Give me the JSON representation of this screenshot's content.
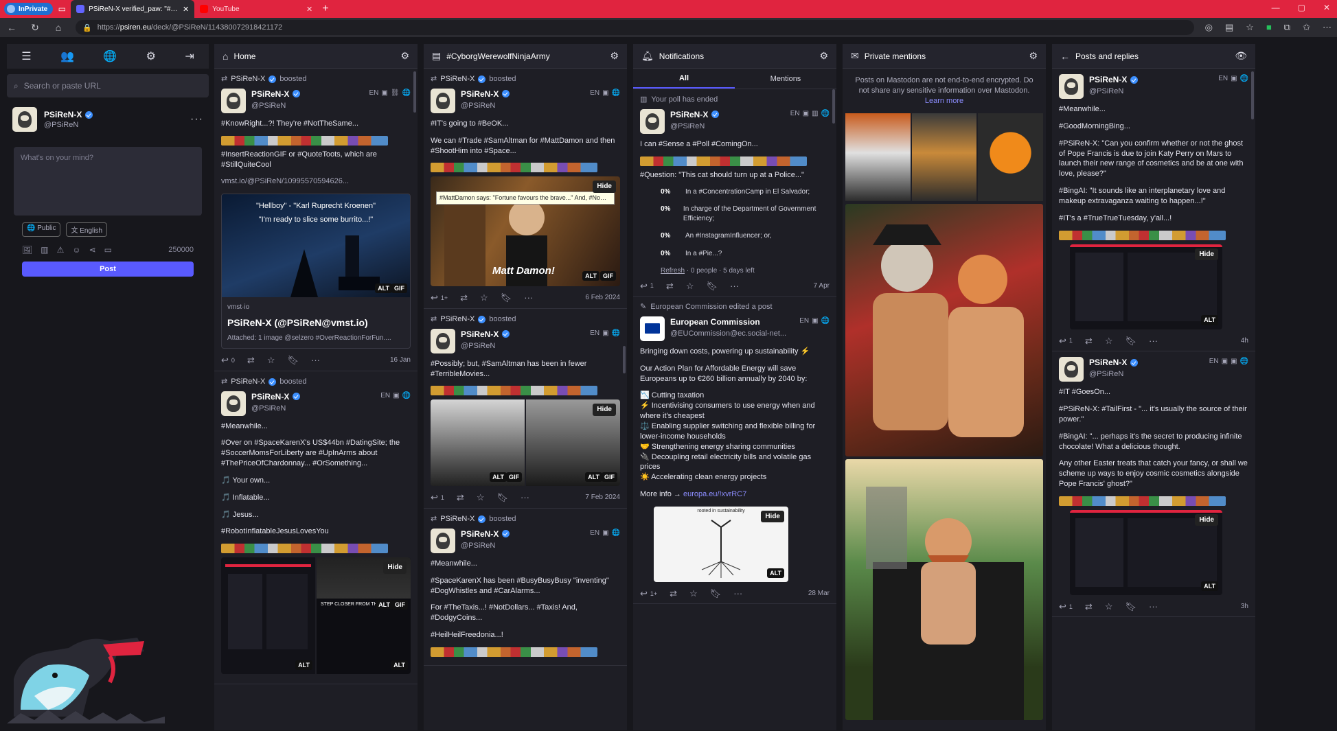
{
  "browser": {
    "inprivate_label": "InPrivate",
    "tabs": [
      {
        "title": "PSiReN-X verified_paw: \"#Yup...",
        "active": true
      },
      {
        "title": "YouTube",
        "active": false
      }
    ],
    "url_prefix": "https://",
    "url_host": "psiren.eu",
    "url_path": "/deck/@PSiReN/114380072918421172"
  },
  "compose": {
    "search_placeholder": "Search or paste URL",
    "display_name": "PSiReN-X",
    "handle": "@PSiReN",
    "placeholder": "What's on your mind?",
    "visibility": "Public",
    "language": "English",
    "char_count": "250000",
    "post_label": "Post"
  },
  "columns": {
    "home": {
      "title": "Home",
      "posts": [
        {
          "boosted_by": "PSiReN-X",
          "boost_label": "boosted",
          "name": "PSiReN-X",
          "handle": "@PSiReN",
          "lang": "EN",
          "p1": "#KnowRight...?! They're #NotTheSame...",
          "p2": "#InsertReactionGIF or #QuoteToots, which are #StillQuiteCool",
          "link": "vmst.io/@PSiReN/10995570594626...",
          "card_quote1": "\"Hellboy\" - \"Karl Ruprecht Kroenen\"",
          "card_quote2": "\"I'm ready to slice some burrito...!\"",
          "card_domain": "vmst·io",
          "card_title": "PSiReN-X (@PSiReN@vmst.io)",
          "card_desc": "Attached: 1 image @selzero #OverReactionForFun....",
          "replies": "0",
          "date": "16 Jan"
        },
        {
          "boosted_by": "PSiReN-X",
          "boost_label": "boosted",
          "name": "PSiReN-X",
          "handle": "@PSiReN",
          "lang": "EN",
          "p1": "#Meanwhile...",
          "p2": "#Over on #SpaceKarenX's US$44bn #DatingSite; the #SoccerMomsForLiberty are #UpInArms about #ThePriceOfChardonnay... #OrSomething...",
          "p3": "🎵 Your own...",
          "p4": "🎵 Inflatable...",
          "p5": "🎵 Jesus...",
          "p6": "#RobotInflatableJesusLovesYou",
          "hide": "Hide",
          "media_caption": "STEP CLOSER FROM THE CHIL..."
        }
      ]
    },
    "hashtag": {
      "title": "#CyborgWerewolfNinjaArmy",
      "posts": [
        {
          "boosted_by": "PSiReN-X",
          "boost_label": "boosted",
          "name": "PSiReN-X",
          "handle": "@PSiReN",
          "lang": "EN",
          "p1": "#IT's going to #BeOK...",
          "p2": "We can #Trade #SamAltman for #MattDamon and then #ShootHim into #Space...",
          "hide": "Hide",
          "tooltip": "#MattDamon says: \"Fortune favours the brave...\" And, #NoOneCares what #MattDamon has to say...",
          "caption": "Matt Damon!",
          "replies": "1+",
          "date": "6 Feb 2024"
        },
        {
          "boosted_by": "PSiReN-X",
          "boost_label": "boosted",
          "name": "PSiReN-X",
          "handle": "@PSiReN",
          "lang": "EN",
          "p1": "#Possibly; but, #SamAltman has been in fewer #TerribleMovies...",
          "hide": "Hide",
          "replies": "1",
          "date": "7 Feb 2024"
        },
        {
          "boosted_by": "PSiReN-X",
          "boost_label": "boosted",
          "name": "PSiReN-X",
          "handle": "@PSiReN",
          "lang": "EN",
          "p1": "#Meanwhile...",
          "p2": "#SpaceKarenX has been #BusyBusyBusy \"inventing\" #DogWhistles and #CarAlarms...",
          "p3": "For #TheTaxis...! #NotDollars... #Taxis! And, #DodgyCoins...",
          "p4": "#HeilHeilFreedonia...!"
        }
      ]
    },
    "notifications": {
      "title": "Notifications",
      "tab_all": "All",
      "tab_mentions": "Mentions",
      "poll_notice": "Your poll has ended",
      "poll_post": {
        "name": "PSiReN-X",
        "handle": "@PSiReN",
        "lang": "EN",
        "p1": "I can #Sense a #Poll #ComingOn...",
        "p2": "#Question: \"This cat should turn up at a Police...\"",
        "options": [
          {
            "pct": "0%",
            "label": "In a #ConcentrationCamp in El Salvador;"
          },
          {
            "pct": "0%",
            "label": "In charge of the Department of Government Efficiency;"
          },
          {
            "pct": "0%",
            "label": "An #InstagramInfluencer; or,"
          },
          {
            "pct": "0%",
            "label": "In a #Pie...?"
          }
        ],
        "refresh": "Refresh",
        "poll_meta": " · 0 people · 5 days left",
        "replies": "1",
        "date": "7 Apr"
      },
      "edit_notice": "European Commission edited a post",
      "ec_post": {
        "name": "European Commission",
        "handle": "@EUCommission@ec.social-net...",
        "lang": "EN",
        "p1": "Bringing down costs, powering up sustainability ⚡",
        "p2": "Our Action Plan for Affordable Energy will save Europeans up to €260 billion annually by 2040 by:",
        "bullets": [
          "📉 Cutting taxation",
          "⚡ Incentivising consumers to use energy when and where it's cheapest",
          "⚖️ Enabling supplier switching and flexible billing for lower-income households",
          "🤝 Strengthening energy sharing communities",
          "🔌 Decoupling retail electricity bills and volatile gas prices",
          "☀️ Accelerating clean energy projects"
        ],
        "more_info": "More info →",
        "more_link": "europa.eu/!xvrRC7",
        "img_caption": "rooted in sustainability",
        "hide": "Hide",
        "replies": "1+",
        "date": "28 Mar"
      }
    },
    "private": {
      "title": "Private mentions",
      "note": "Posts on Mastodon are not end-to-end encrypted. Do not share any sensitive information over Mastodon.",
      "learn_more": "Learn more"
    },
    "replies": {
      "title": "Posts and replies",
      "posts": [
        {
          "name": "PSiReN-X",
          "handle": "@PSiReN",
          "lang": "EN",
          "p1": "#Meanwhile...",
          "p2": "#GoodMorningBing...",
          "p3": "#PSiReN-X: \"Can you confirm whether or not the ghost of Pope Francis is due to join Katy Perry on Mars to launch their new range of cosmetics and be at one with love, please?\"",
          "p4": "#BingAI: \"It sounds like an interplanetary love and makeup extravaganza waiting to happen...!\"",
          "p5": "#IT's a #TrueTrueTuesday, y'all...!",
          "hide": "Hide",
          "replies": "1",
          "date": "4h"
        },
        {
          "name": "PSiReN-X",
          "handle": "@PSiReN",
          "lang": "EN",
          "p1": "#IT #GoesOn...",
          "p2": "#PSiReN-X: #TailFirst - \"... it's usually the source of their power.\"",
          "p3": "#BingAI: \"... perhaps it's the secret to producing infinite chocolate! What a delicious thought.",
          "p4": "Any other Easter treats that catch your fancy, or shall we scheme up ways to enjoy cosmic cosmetics alongside Pope Francis' ghost?\"",
          "hide": "Hide",
          "replies": "1",
          "date": "3h"
        }
      ]
    }
  },
  "colors": {
    "accent": "#595aff",
    "hashtag": "#8c8dff",
    "tabbar": "#e0243f",
    "verified": "#3c8fff"
  }
}
